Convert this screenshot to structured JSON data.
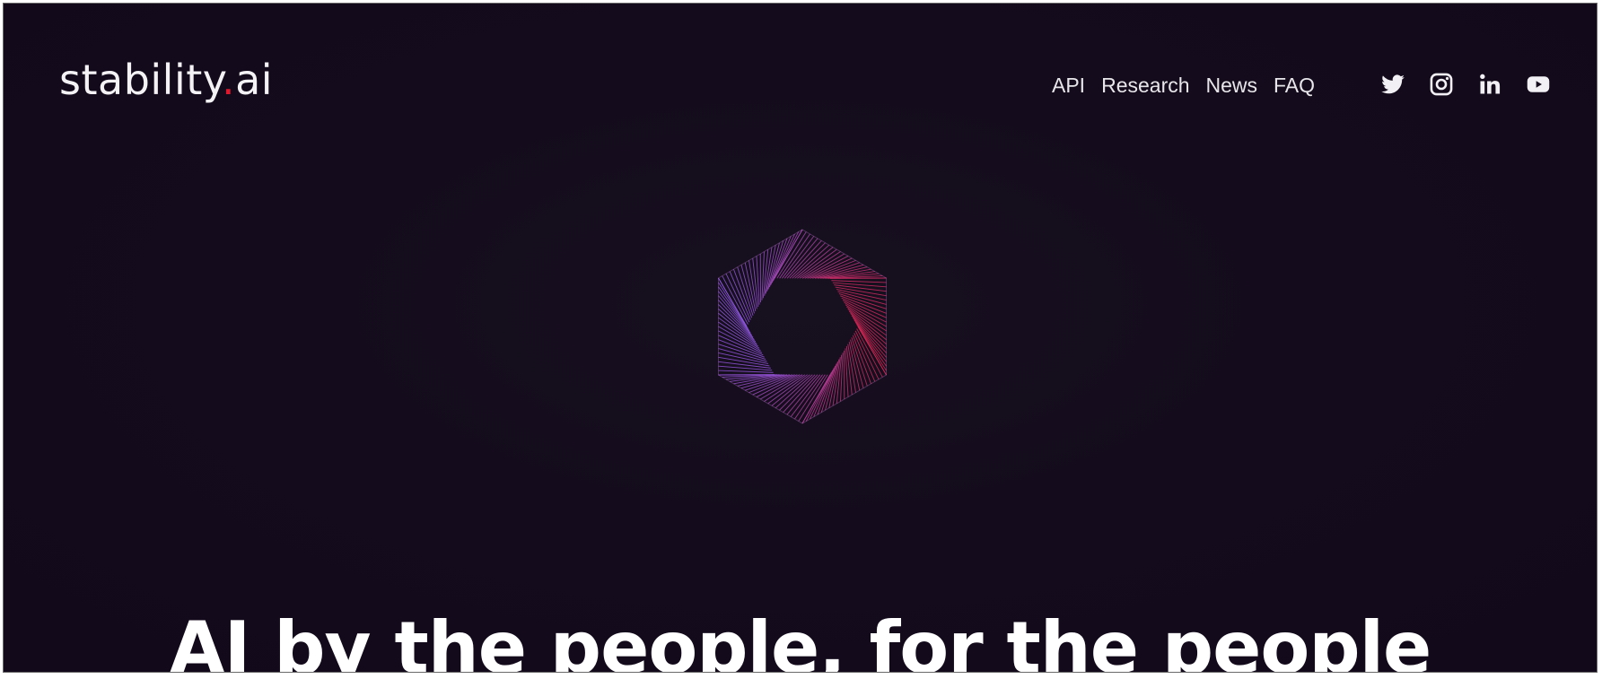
{
  "header": {
    "logo": {
      "name_part": "stability",
      "dot": ".",
      "suffix": "ai",
      "dot_color": "#e0182d"
    },
    "nav": [
      {
        "label": "API"
      },
      {
        "label": "Research"
      },
      {
        "label": "News"
      },
      {
        "label": "FAQ"
      }
    ],
    "social_icons": [
      "twitter-icon",
      "instagram-icon",
      "linkedin-icon",
      "youtube-icon"
    ]
  },
  "hero": {
    "emblem": {
      "icon": "hexagon-emblem",
      "colors": {
        "violet": "#8a5cf0",
        "red": "#e8192e"
      }
    },
    "headline": "AI by the people, for the people"
  },
  "theme": {
    "background": "#140c1c",
    "text": "#ffffff"
  }
}
